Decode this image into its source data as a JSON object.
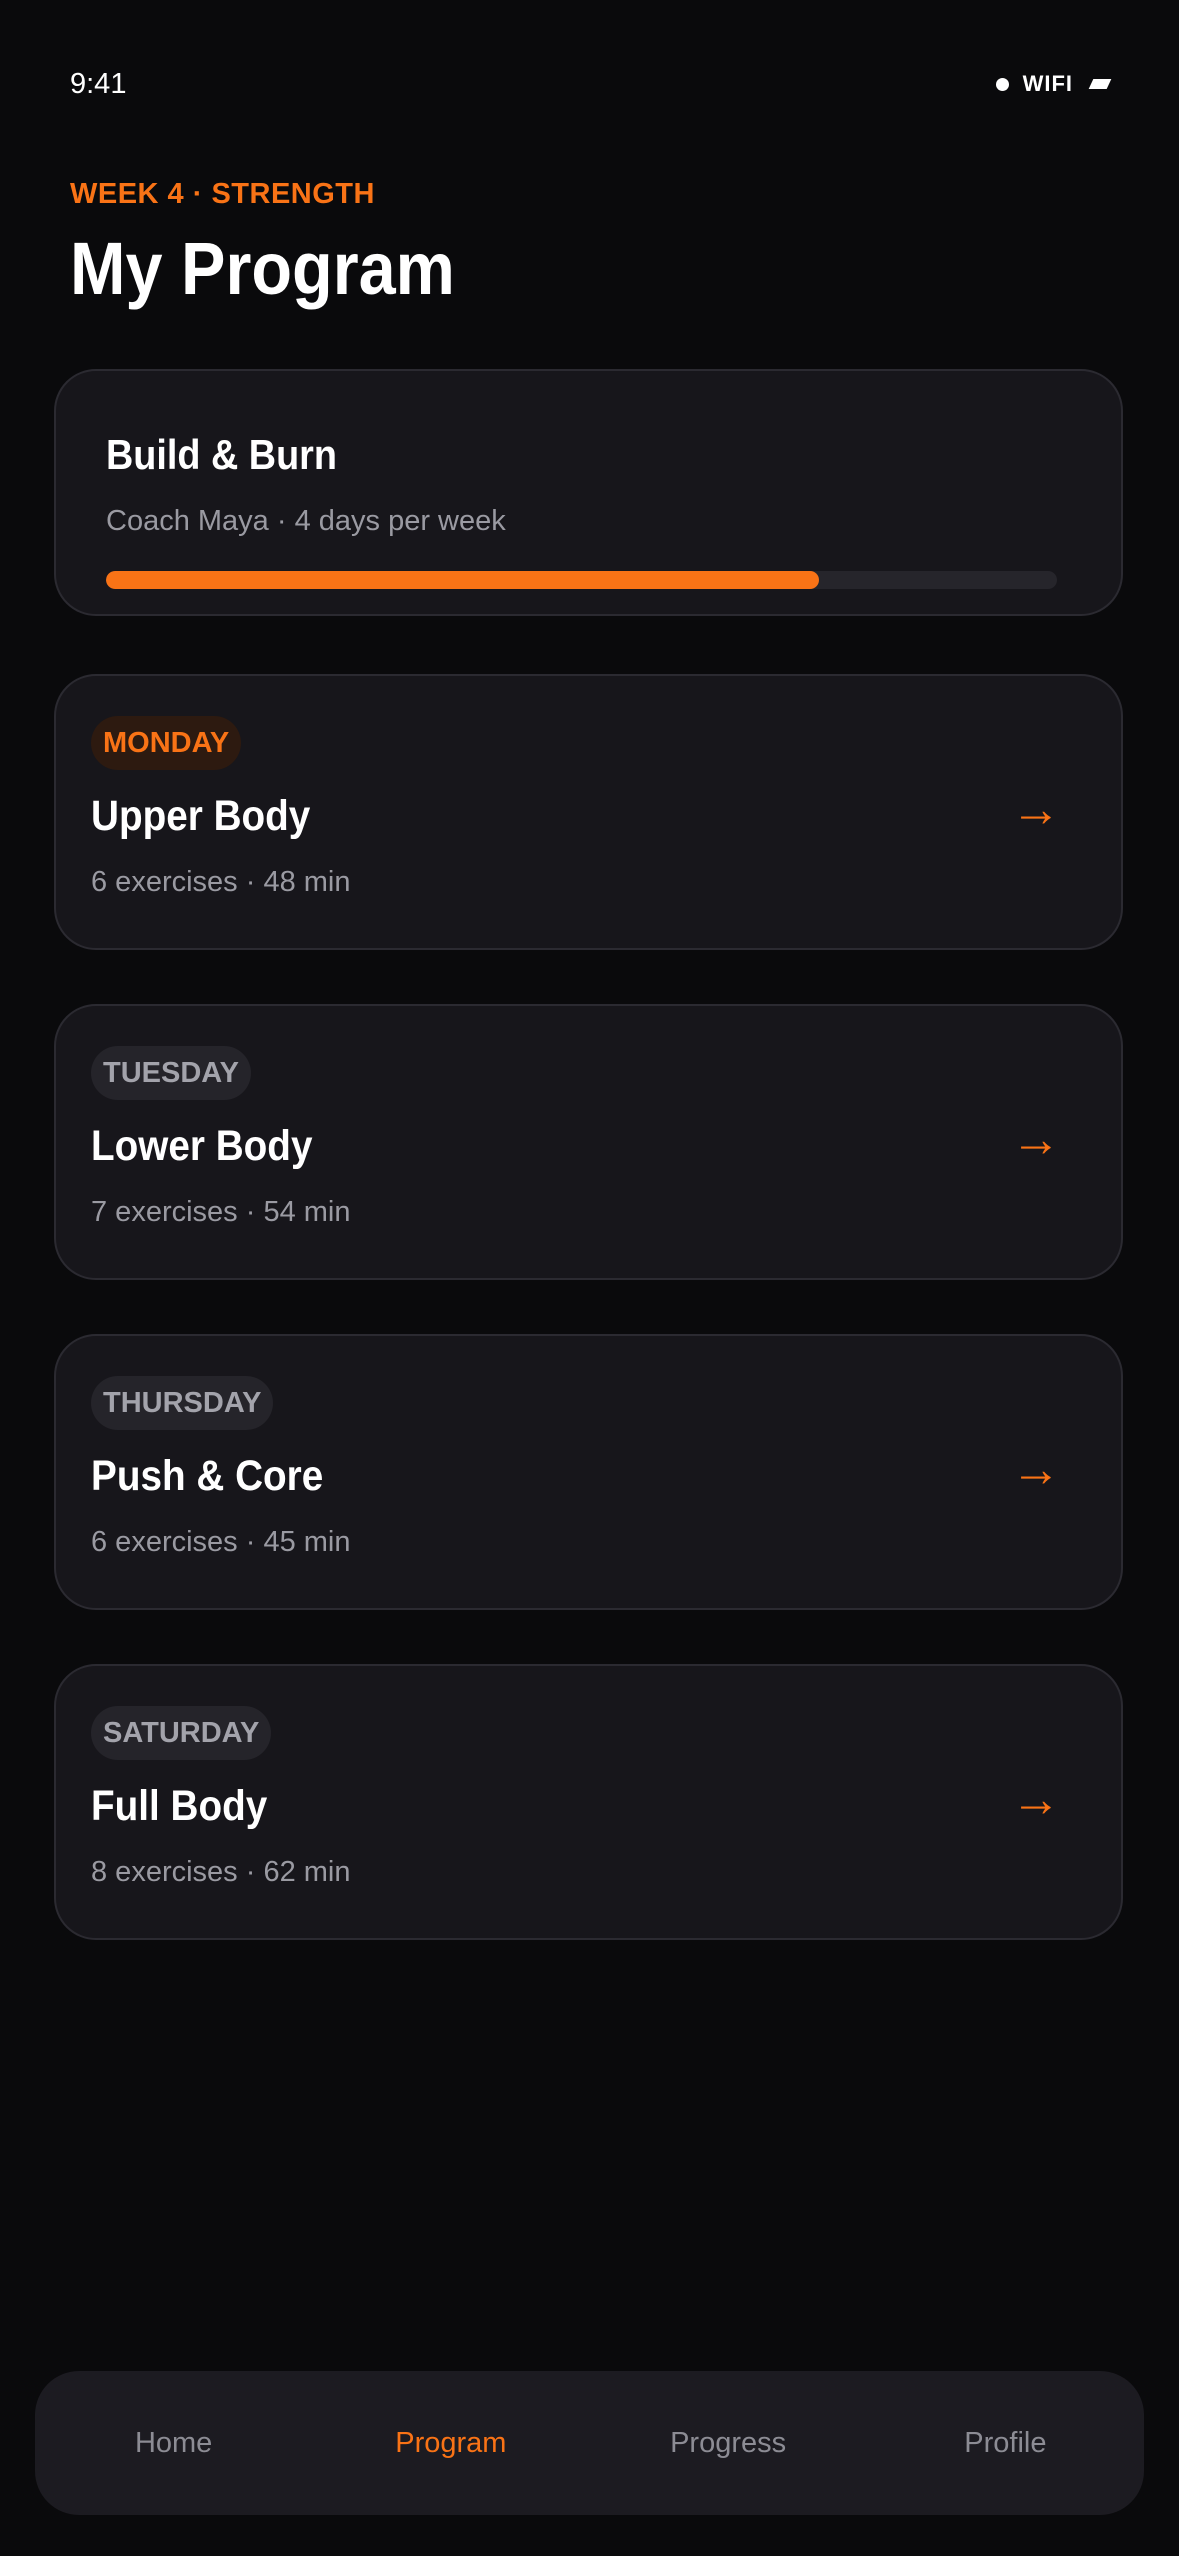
{
  "status_bar": {
    "time": "9:41",
    "network": "WIFI"
  },
  "header": {
    "eyebrow": "WEEK 4 · STRENGTH",
    "title": "My Program"
  },
  "program": {
    "name": "Build & Burn",
    "meta": "Coach Maya · 4 days per week",
    "progress_fraction": 0.75
  },
  "days": [
    {
      "day": "MONDAY",
      "title": "Upper Body",
      "meta": "6 exercises · 48 min",
      "active": true
    },
    {
      "day": "TUESDAY",
      "title": "Lower Body",
      "meta": "7 exercises · 54 min",
      "active": false
    },
    {
      "day": "THURSDAY",
      "title": "Push & Core",
      "meta": "6 exercises · 45 min",
      "active": false
    },
    {
      "day": "SATURDAY",
      "title": "Full Body",
      "meta": "8 exercises · 62 min",
      "active": false
    }
  ],
  "arrow_glyph": "→",
  "nav": {
    "items": [
      {
        "label": "Home",
        "active": false
      },
      {
        "label": "Program",
        "active": true
      },
      {
        "label": "Progress",
        "active": false
      },
      {
        "label": "Profile",
        "active": false
      }
    ]
  },
  "colors": {
    "accent": "#f97316",
    "background": "#0a0a0c",
    "card": "#17161b",
    "muted_text": "#9a9aa2"
  },
  "icons": {
    "status_signal": "signal-dot-icon",
    "status_battery": "battery-icon",
    "card_arrow": "arrow-right-icon"
  }
}
